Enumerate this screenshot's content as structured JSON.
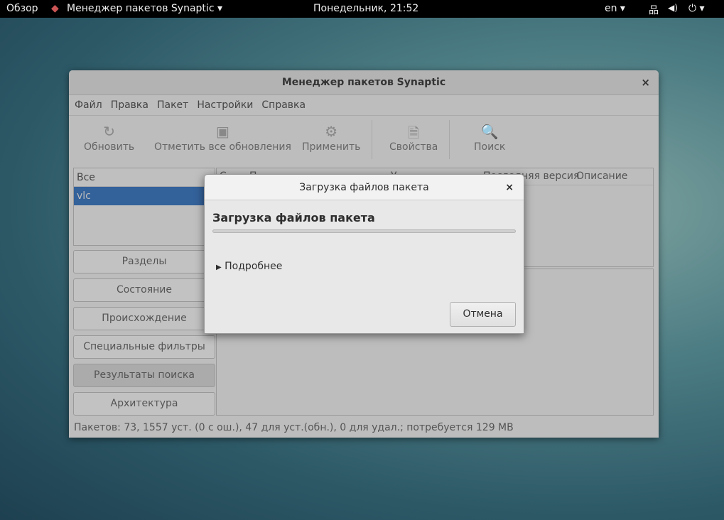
{
  "topbar": {
    "activities": "Обзор",
    "app": "Менеджер пакетов Synaptic ▾",
    "clock": "Понедельник, 21:52",
    "lang": "en ▾",
    "network": "⚡",
    "volume": "🔊",
    "power": "⏻ ▾"
  },
  "window": {
    "title": "Менеджер пакетов Synaptic",
    "close": "×",
    "menu": [
      "Файл",
      "Правка",
      "Пакет",
      "Настройки",
      "Справка"
    ],
    "toolbar": [
      {
        "label": "Обновить",
        "icon": "↻"
      },
      {
        "label": "Отметить все обновления",
        "icon": "▣"
      },
      {
        "label": "Применить",
        "icon": "⚙"
      },
      {
        "label": "Свойства",
        "icon": "🗎"
      },
      {
        "label": "Поиск",
        "icon": "🔍"
      }
    ],
    "list": {
      "header": "Все",
      "items": [
        "vlc"
      ]
    },
    "filters": [
      "Разделы",
      "Состояние",
      "Происхождение",
      "Специальные фильтры",
      "Результаты поиска",
      "Архитектура"
    ],
    "table_headers": [
      "С",
      "П",
      "У",
      "Последняя версия",
      "Описание"
    ],
    "status": "Пакетов: 73, 1557 уст. (0 с ош.), 47 для уст.(обн.), 0 для удал.; потребуется 129 MB"
  },
  "dialog": {
    "title": "Загрузка файлов пакета",
    "close": "×",
    "heading": "Загрузка файлов пакета",
    "progress": 0,
    "details": "Подробнее",
    "cancel": "Отмена"
  }
}
